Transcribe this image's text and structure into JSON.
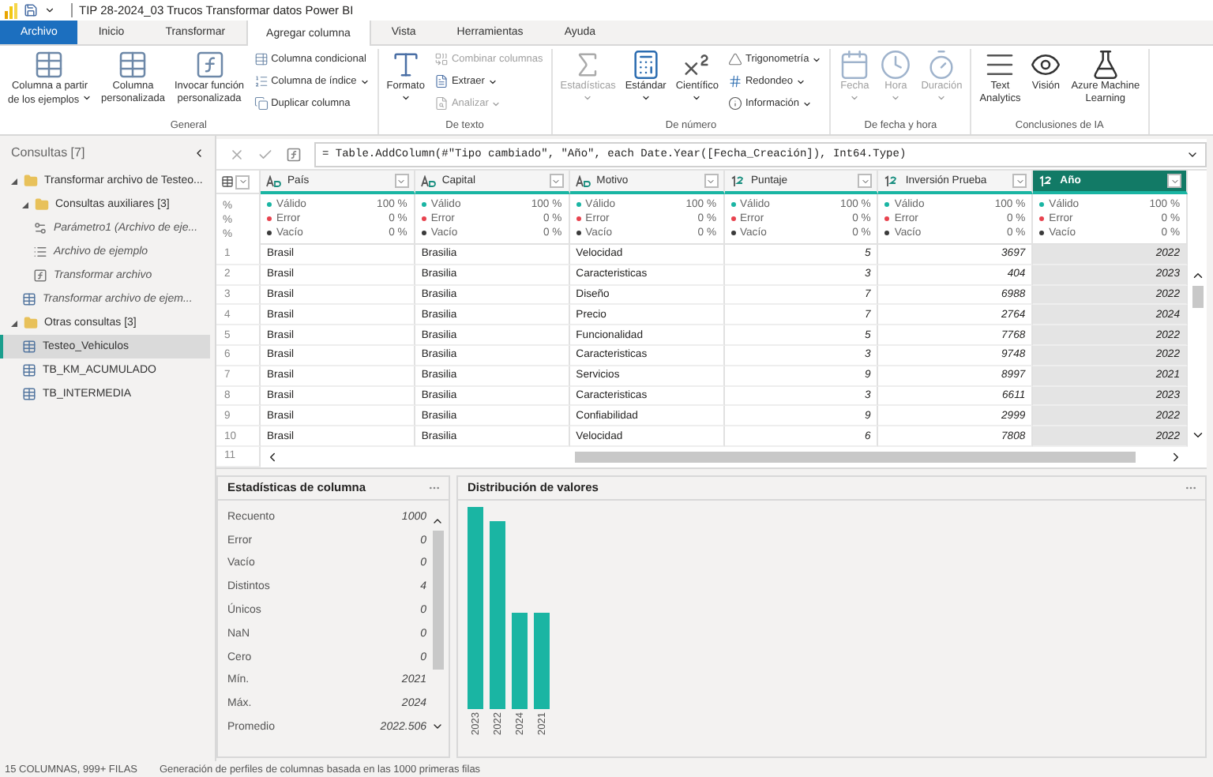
{
  "title_bar": {
    "title": "TIP 28-2024_03 Trucos Transformar datos Power BI"
  },
  "tabs": [
    {
      "label": "Archivo",
      "kind": "file",
      "selected": false
    },
    {
      "label": "Inicio",
      "kind": "tab",
      "selected": false
    },
    {
      "label": "Transformar",
      "kind": "tab",
      "selected": false
    },
    {
      "label": "Agregar columna",
      "kind": "tab",
      "selected": true
    },
    {
      "label": "Vista",
      "kind": "tab",
      "selected": false
    },
    {
      "label": "Herramientas",
      "kind": "tab",
      "selected": false
    },
    {
      "label": "Ayuda",
      "kind": "tab",
      "selected": false
    }
  ],
  "ribbon": [
    {
      "label": "General",
      "items": [
        {
          "kind": "large",
          "lines": [
            "Columna a partir",
            "de los ejemplos"
          ],
          "caret": true,
          "disabled": false
        },
        {
          "kind": "large",
          "lines": [
            "Columna",
            "personalizada"
          ],
          "caret": false,
          "disabled": false
        },
        {
          "kind": "large",
          "lines": [
            "Invocar función",
            "personalizada"
          ],
          "caret": false,
          "disabled": false
        },
        {
          "kind": "stack",
          "buttons": [
            {
              "label": "Columna condicional",
              "caret": false,
              "disabled": false
            },
            {
              "label": "Columna de índice",
              "caret": true,
              "disabled": false
            },
            {
              "label": "Duplicar columna",
              "caret": false,
              "disabled": false
            }
          ]
        }
      ]
    },
    {
      "label": "De texto",
      "items": [
        {
          "kind": "large",
          "lines": [
            "Formato"
          ],
          "caret": true,
          "disabled": false
        },
        {
          "kind": "stack",
          "buttons": [
            {
              "label": "Combinar columnas",
              "caret": false,
              "disabled": true
            },
            {
              "label": "Extraer",
              "caret": true,
              "disabled": false
            },
            {
              "label": "Analizar",
              "caret": true,
              "disabled": true
            }
          ]
        }
      ]
    },
    {
      "label": "De número",
      "items": [
        {
          "kind": "large",
          "lines": [
            "Estadísticas"
          ],
          "caret": true,
          "disabled": true
        },
        {
          "kind": "large",
          "lines": [
            "Estándar"
          ],
          "caret": true,
          "disabled": false
        },
        {
          "kind": "large",
          "lines": [
            "Científico"
          ],
          "caret": true,
          "disabled": false
        },
        {
          "kind": "stack",
          "buttons": [
            {
              "label": "Trigonometría",
              "caret": true,
              "disabled": false
            },
            {
              "label": "Redondeo",
              "caret": true,
              "disabled": false
            },
            {
              "label": "Información",
              "caret": true,
              "disabled": false
            }
          ]
        }
      ]
    },
    {
      "label": "De fecha y hora",
      "items": [
        {
          "kind": "large",
          "lines": [
            "Fecha"
          ],
          "caret": true,
          "disabled": true
        },
        {
          "kind": "large",
          "lines": [
            "Hora"
          ],
          "caret": true,
          "disabled": true
        },
        {
          "kind": "large",
          "lines": [
            "Duración"
          ],
          "caret": true,
          "disabled": true
        }
      ]
    },
    {
      "label": "Conclusiones de IA",
      "items": [
        {
          "kind": "large",
          "lines": [
            "Text",
            "Analytics"
          ],
          "caret": false,
          "disabled": false
        },
        {
          "kind": "large",
          "lines": [
            "Visión"
          ],
          "caret": false,
          "disabled": false
        },
        {
          "kind": "large",
          "lines": [
            "Azure Machine",
            "Learning"
          ],
          "caret": false,
          "disabled": false
        }
      ]
    }
  ],
  "queries": {
    "title": "Consultas [7]",
    "tree": [
      {
        "label": "Transformar archivo de Testeo...",
        "kind": "folder",
        "expanded": true,
        "selected": false,
        "loaded": true,
        "children": [
          {
            "label": "Consultas auxiliares [3]",
            "kind": "folder",
            "expanded": true,
            "selected": false,
            "loaded": true,
            "children": [
              {
                "label": "Parámetro1 (Archivo de eje...",
                "kind": "parameter",
                "selected": false,
                "loaded": false
              },
              {
                "label": "Archivo de ejemplo",
                "kind": "list",
                "selected": false,
                "loaded": false
              },
              {
                "label": "Transformar archivo",
                "kind": "function",
                "selected": false,
                "loaded": false
              }
            ]
          },
          {
            "label": "Transformar archivo de ejem...",
            "kind": "table",
            "selected": false,
            "loaded": false
          }
        ]
      },
      {
        "label": "Otras consultas [3]",
        "kind": "folder",
        "expanded": true,
        "selected": false,
        "loaded": true,
        "children": [
          {
            "label": "Testeo_Vehiculos",
            "kind": "table",
            "selected": true,
            "loaded": true
          },
          {
            "label": "TB_KM_ACUMULADO",
            "kind": "table",
            "selected": false,
            "loaded": true
          },
          {
            "label": "TB_INTERMEDIA",
            "kind": "table",
            "selected": false,
            "loaded": true
          }
        ]
      }
    ]
  },
  "formula": {
    "text": "= Table.AddColumn(#\"Tipo cambiado\", \"Año\", each Date.Year([Fecha_Creación]), Int64.Type)"
  },
  "profile_marks": [
    "%",
    "%",
    "%"
  ],
  "columns": [
    {
      "name": "País",
      "kind": "text",
      "selected": false,
      "profile": [
        {
          "label": "Válido",
          "value": "100 %",
          "color": "#1ab5a3"
        },
        {
          "label": "Error",
          "value": "0 %",
          "color": "#e8434f"
        },
        {
          "label": "Vacío",
          "value": "0 %",
          "color": "#3a3a3a"
        }
      ]
    },
    {
      "name": "Capital",
      "kind": "text",
      "selected": false,
      "profile": [
        {
          "label": "Válido",
          "value": "100 %",
          "color": "#1ab5a3"
        },
        {
          "label": "Error",
          "value": "0 %",
          "color": "#e8434f"
        },
        {
          "label": "Vacío",
          "value": "0 %",
          "color": "#3a3a3a"
        }
      ]
    },
    {
      "name": "Motivo",
      "kind": "text",
      "selected": false,
      "profile": [
        {
          "label": "Válido",
          "value": "100 %",
          "color": "#1ab5a3"
        },
        {
          "label": "Error",
          "value": "0 %",
          "color": "#e8434f"
        },
        {
          "label": "Vacío",
          "value": "0 %",
          "color": "#3a3a3a"
        }
      ]
    },
    {
      "name": "Puntaje",
      "kind": "int",
      "selected": false,
      "profile": [
        {
          "label": "Válido",
          "value": "100 %",
          "color": "#1ab5a3"
        },
        {
          "label": "Error",
          "value": "0 %",
          "color": "#e8434f"
        },
        {
          "label": "Vacío",
          "value": "0 %",
          "color": "#3a3a3a"
        }
      ]
    },
    {
      "name": "Inversión Prueba",
      "kind": "int",
      "selected": false,
      "profile": [
        {
          "label": "Válido",
          "value": "100 %",
          "color": "#1ab5a3"
        },
        {
          "label": "Error",
          "value": "0 %",
          "color": "#e8434f"
        },
        {
          "label": "Vacío",
          "value": "0 %",
          "color": "#3a3a3a"
        }
      ]
    },
    {
      "name": "Año",
      "kind": "int",
      "selected": true,
      "profile": [
        {
          "label": "Válido",
          "value": "100 %",
          "color": "#1ab5a3"
        },
        {
          "label": "Error",
          "value": "0 %",
          "color": "#e8434f"
        },
        {
          "label": "Vacío",
          "value": "0 %",
          "color": "#3a3a3a"
        }
      ]
    }
  ],
  "rows": [
    {
      "number": "1",
      "cells": [
        "Brasil",
        "Brasilia",
        "Velocidad",
        "5",
        "3697",
        "2022"
      ]
    },
    {
      "number": "2",
      "cells": [
        "Brasil",
        "Brasilia",
        "Caracteristicas",
        "3",
        "404",
        "2023"
      ]
    },
    {
      "number": "3",
      "cells": [
        "Brasil",
        "Brasilia",
        "Diseño",
        "7",
        "6988",
        "2022"
      ]
    },
    {
      "number": "4",
      "cells": [
        "Brasil",
        "Brasilia",
        "Precio",
        "7",
        "2764",
        "2024"
      ]
    },
    {
      "number": "5",
      "cells": [
        "Brasil",
        "Brasilia",
        "Funcionalidad",
        "5",
        "7768",
        "2022"
      ]
    },
    {
      "number": "6",
      "cells": [
        "Brasil",
        "Brasilia",
        "Caracteristicas",
        "3",
        "9748",
        "2022"
      ]
    },
    {
      "number": "7",
      "cells": [
        "Brasil",
        "Brasilia",
        "Servicios",
        "9",
        "8997",
        "2021"
      ]
    },
    {
      "number": "8",
      "cells": [
        "Brasil",
        "Brasilia",
        "Caracteristicas",
        "3",
        "6611",
        "2023"
      ]
    },
    {
      "number": "9",
      "cells": [
        "Brasil",
        "Brasilia",
        "Confiabilidad",
        "9",
        "2999",
        "2022"
      ]
    },
    {
      "number": "10",
      "cells": [
        "Brasil",
        "Brasilia",
        "Velocidad",
        "6",
        "7808",
        "2022"
      ]
    }
  ],
  "last_row_number": "11",
  "stats": {
    "title": "Estadísticas de columna",
    "rows": [
      {
        "label": "Recuento",
        "value": "1000"
      },
      {
        "label": "Error",
        "value": "0"
      },
      {
        "label": "Vacío",
        "value": "0"
      },
      {
        "label": "Distintos",
        "value": "4"
      },
      {
        "label": "Únicos",
        "value": "0"
      },
      {
        "label": "NaN",
        "value": "0"
      },
      {
        "label": "Cero",
        "value": "0"
      },
      {
        "label": "Mín.",
        "value": "2021"
      },
      {
        "label": "Máx.",
        "value": "2024"
      },
      {
        "label": "Promedio",
        "value": "2022.506"
      }
    ]
  },
  "distribution": {
    "title": "Distribución de valores",
    "labels": [
      "2023",
      "2022",
      "2024",
      "2021"
    ]
  },
  "status_bar": {
    "summary": "15 COLUMNAS, 999+ FILAS",
    "note": "Generación de perfiles de columnas basada en las 1000 primeras filas"
  }
}
